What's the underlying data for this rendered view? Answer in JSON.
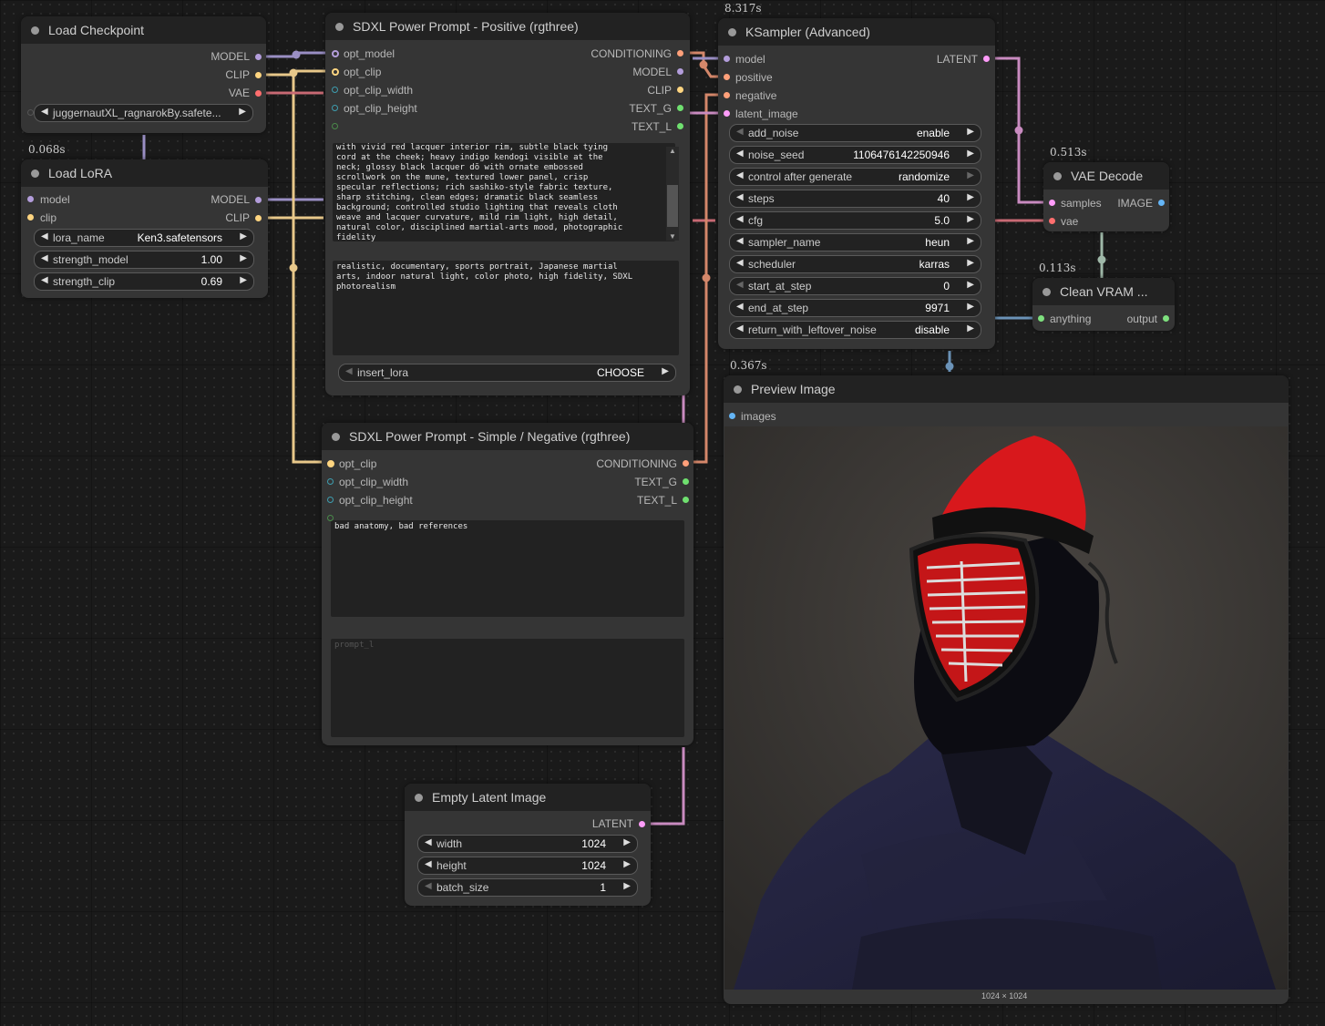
{
  "colors": {
    "model": "#b39ddb",
    "clip": "#ffd580",
    "vae": "#ff6e6e",
    "conditioning": "#ffa07a",
    "latent": "#ff9cf9",
    "image": "#64b5f6",
    "text": "#6fe06f",
    "anything": "#7ee07e"
  },
  "load_checkpoint": {
    "title": "Load Checkpoint",
    "outputs": [
      "MODEL",
      "CLIP",
      "VAE"
    ],
    "ckpt_name": "juggernautXL_ragnarokBy.safete..."
  },
  "load_lora": {
    "time": "0.068s",
    "title": "Load LoRA",
    "inputs": [
      "model",
      "clip"
    ],
    "outputs": [
      "MODEL",
      "CLIP"
    ],
    "widgets": [
      {
        "label": "lora_name",
        "value": "Ken3.safetensors"
      },
      {
        "label": "strength_model",
        "value": "1.00"
      },
      {
        "label": "strength_clip",
        "value": "0.69"
      }
    ]
  },
  "positive_prompt": {
    "title": "SDXL Power Prompt - Positive (rgthree)",
    "inputs": [
      "opt_model",
      "opt_clip",
      "opt_clip_width",
      "opt_clip_height"
    ],
    "outputs": [
      "CONDITIONING",
      "MODEL",
      "CLIP",
      "TEXT_G",
      "TEXT_L"
    ],
    "text_g": "with vivid red lacquer interior rim, subtle black tying\ncord at the cheek; heavy indigo kendogi visible at the\nneck; glossy black lacquer dō with ornate embossed\nscrollwork on the mune, textured lower panel, crisp\nspecular reflections; rich sashiko-style fabric texture,\nsharp stitching, clean edges; dramatic black seamless\nbackground; controlled studio lighting that reveals cloth\nweave and lacquer curvature, mild rim light, high detail,\nnatural color, disciplined martial-arts mood, photographic\nfidelity",
    "text_l": "realistic, documentary, sports portrait, Japanese martial\narts, indoor natural light, color photo, high fidelity, SDXL\nphotorealism",
    "insert_lora_label": "insert_lora",
    "insert_lora_value": "CHOOSE"
  },
  "negative_prompt": {
    "title": "SDXL Power Prompt - Simple / Negative (rgthree)",
    "inputs": [
      "opt_clip",
      "opt_clip_width",
      "opt_clip_height"
    ],
    "outputs": [
      "CONDITIONING",
      "TEXT_G",
      "TEXT_L"
    ],
    "text_g": "bad anatomy, bad references",
    "text_l_placeholder": "prompt_l"
  },
  "ksampler": {
    "time": "8.317s",
    "title": "KSampler (Advanced)",
    "inputs": [
      "model",
      "positive",
      "negative",
      "latent_image"
    ],
    "outputs": [
      "LATENT"
    ],
    "widgets": [
      {
        "label": "add_noise",
        "value": "enable"
      },
      {
        "label": "noise_seed",
        "value": "1106476142250946"
      },
      {
        "label": "control after generate",
        "value": "randomize"
      },
      {
        "label": "steps",
        "value": "40"
      },
      {
        "label": "cfg",
        "value": "5.0"
      },
      {
        "label": "sampler_name",
        "value": "heun"
      },
      {
        "label": "scheduler",
        "value": "karras"
      },
      {
        "label": "start_at_step",
        "value": "0"
      },
      {
        "label": "end_at_step",
        "value": "9971"
      },
      {
        "label": "return_with_leftover_noise",
        "value": "disable"
      }
    ]
  },
  "vae_decode": {
    "time": "0.513s",
    "title": "VAE Decode",
    "inputs": [
      "samples",
      "vae"
    ],
    "outputs": [
      "IMAGE"
    ]
  },
  "clean_vram": {
    "time": "0.113s",
    "title": "Clean VRAM ...",
    "inputs": [
      "anything"
    ],
    "outputs": [
      "output"
    ]
  },
  "preview_image": {
    "time": "0.367s",
    "title": "Preview Image",
    "inputs": [
      "images"
    ],
    "caption": "1024 × 1024"
  },
  "empty_latent": {
    "title": "Empty Latent Image",
    "outputs": [
      "LATENT"
    ],
    "widgets": [
      {
        "label": "width",
        "value": "1024"
      },
      {
        "label": "height",
        "value": "1024"
      },
      {
        "label": "batch_size",
        "value": "1"
      }
    ]
  }
}
